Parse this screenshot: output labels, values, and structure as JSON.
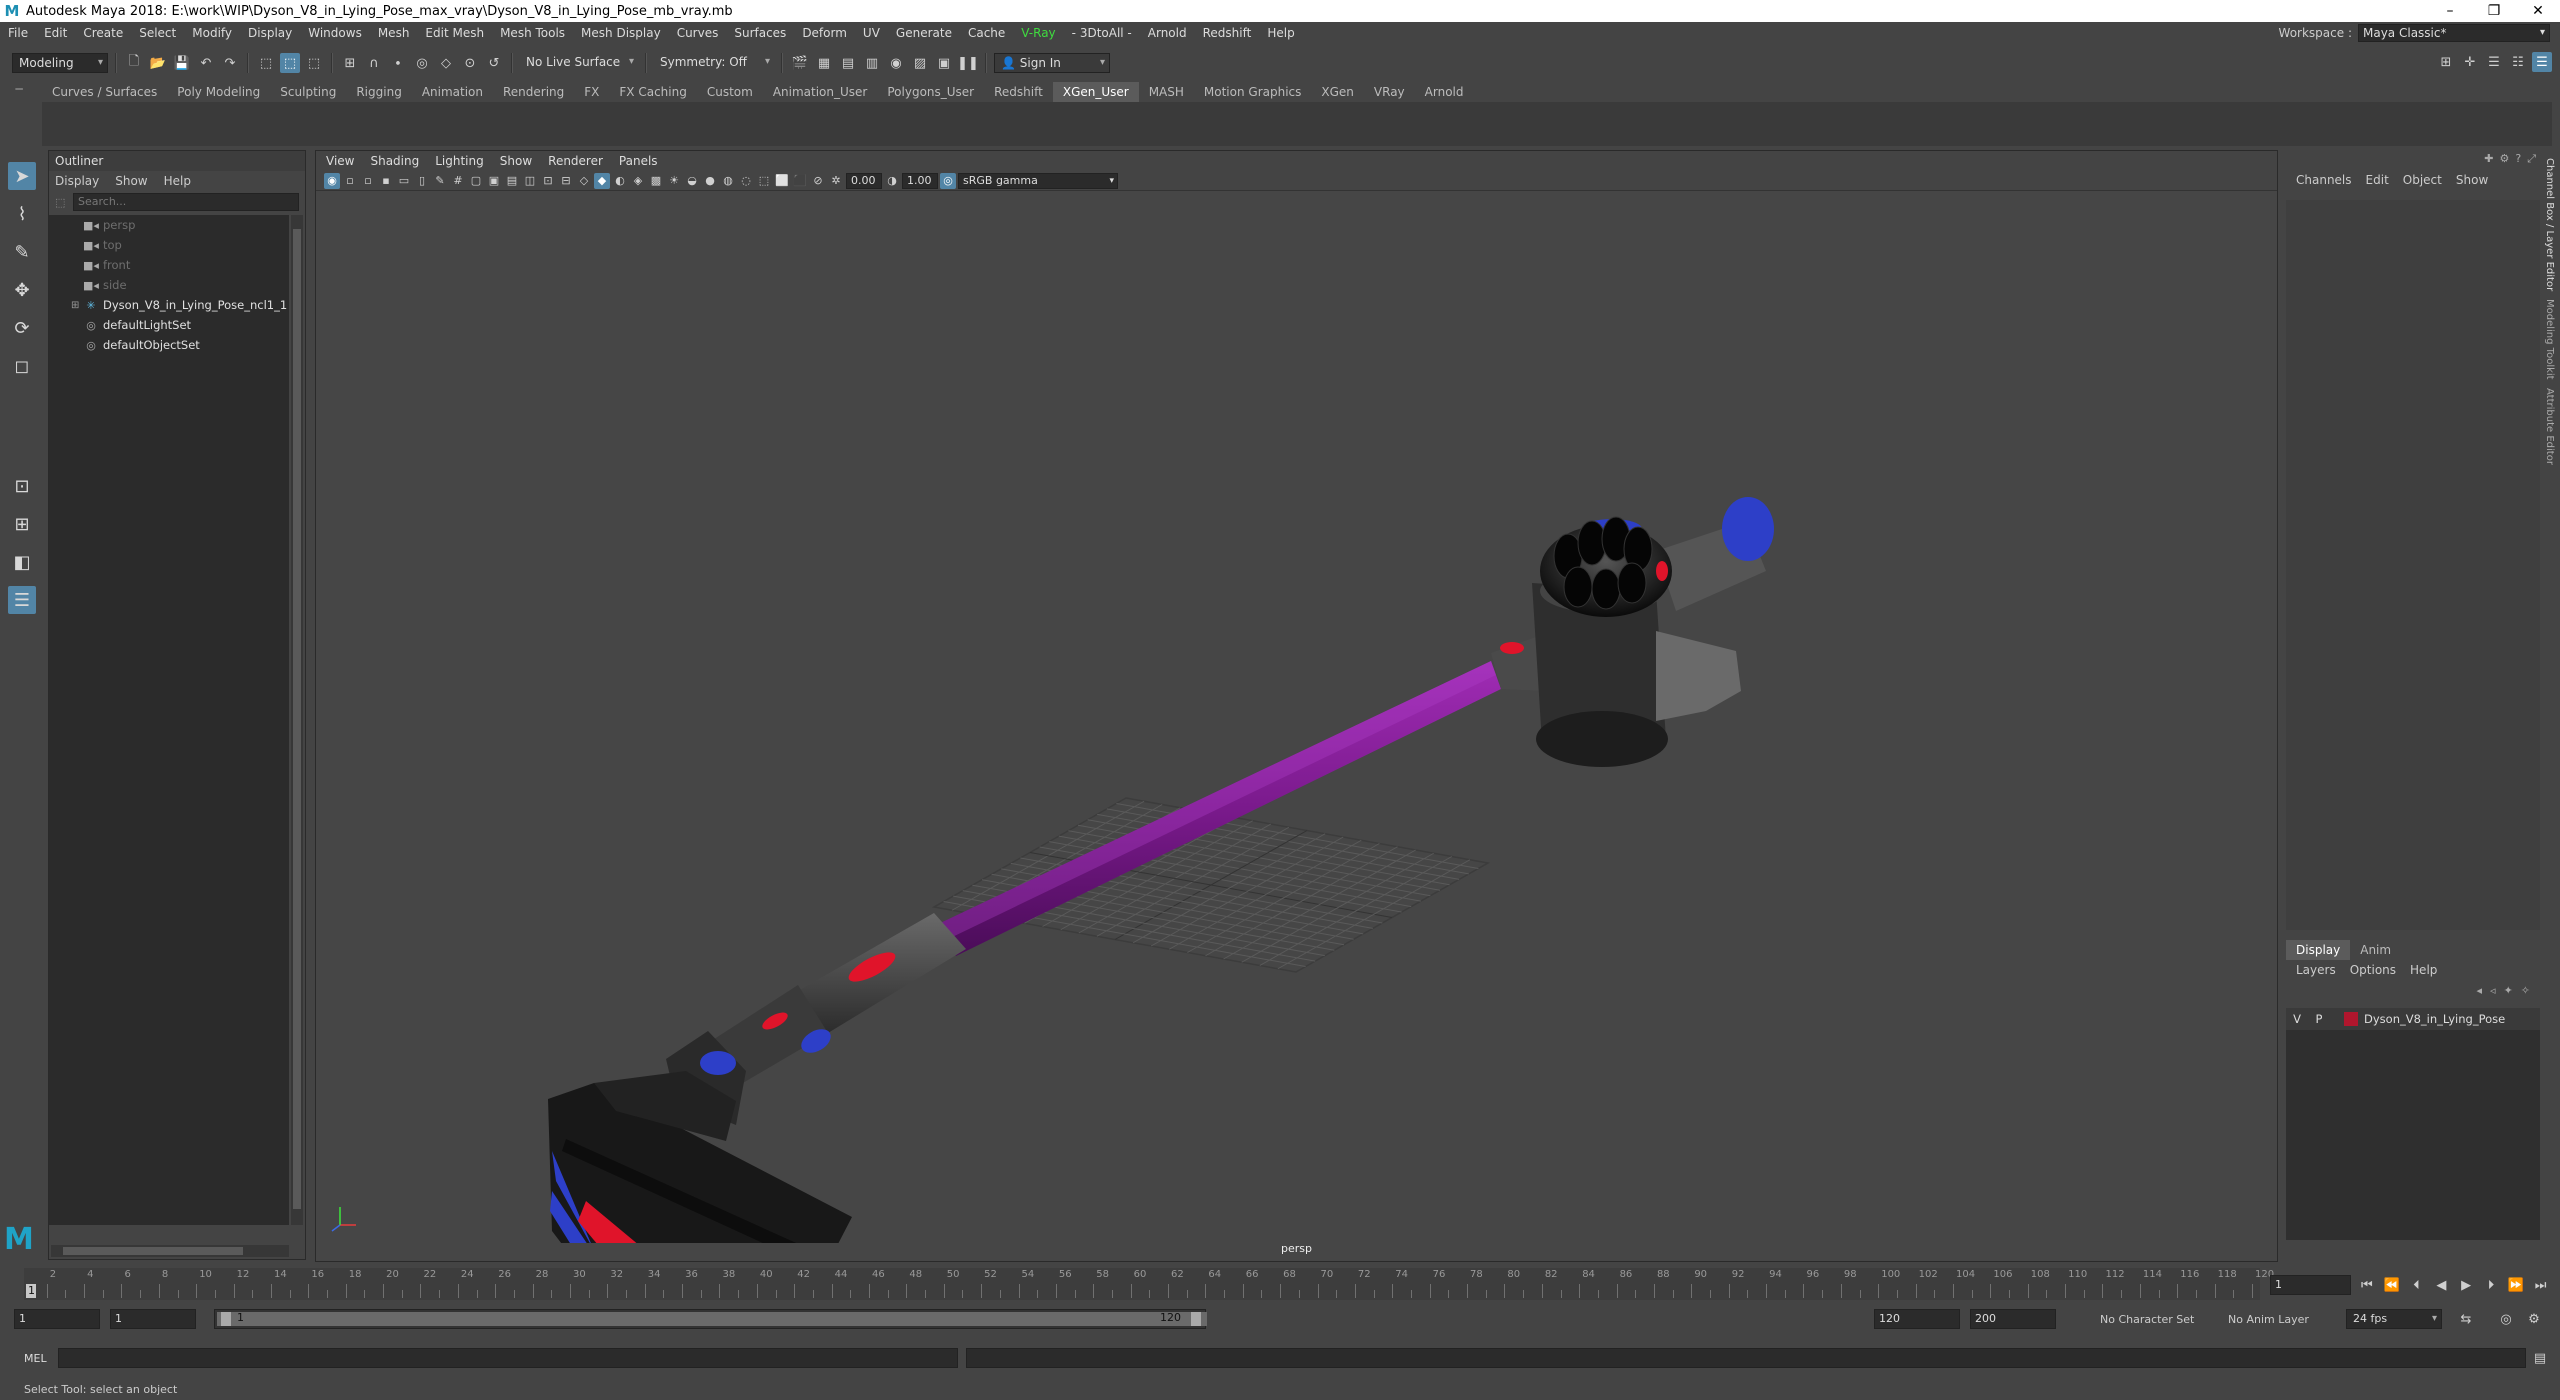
{
  "window": {
    "title": "Autodesk Maya 2018: E:\\work\\WIP\\Dyson_V8_in_Lying_Pose_max_vray\\Dyson_V8_in_Lying_Pose_mb_vray.mb",
    "logo": "M",
    "controls": [
      "–",
      "❐",
      "✕"
    ]
  },
  "menubar": [
    "File",
    "Edit",
    "Create",
    "Select",
    "Modify",
    "Display",
    "Windows",
    "Mesh",
    "Edit Mesh",
    "Mesh Tools",
    "Mesh Display",
    "Curves",
    "Surfaces",
    "Deform",
    "UV",
    "Generate",
    "Cache",
    "V-Ray",
    "- 3DtoAll -",
    "Arnold",
    "Redshift",
    "Help"
  ],
  "workspace": {
    "label": "Workspace :",
    "value": "Maya Classic*"
  },
  "statusline": {
    "mode": "Modeling",
    "live_surface": "No Live Surface",
    "symmetry": "Symmetry: Off",
    "sign_in": "Sign In"
  },
  "shelf_tabs": [
    "Curves / Surfaces",
    "Poly Modeling",
    "Sculpting",
    "Rigging",
    "Animation",
    "Rendering",
    "FX",
    "FX Caching",
    "Custom",
    "Animation_User",
    "Polygons_User",
    "Redshift",
    "XGen_User",
    "MASH",
    "Motion Graphics",
    "XGen",
    "VRay",
    "Arnold"
  ],
  "active_shelf": "XGen_User",
  "outliner": {
    "title": "Outliner",
    "menu": [
      "Display",
      "Show",
      "Help"
    ],
    "search_placeholder": "Search...",
    "items": [
      {
        "name": "persp",
        "type": "camera",
        "dim": true
      },
      {
        "name": "top",
        "type": "camera",
        "dim": true
      },
      {
        "name": "front",
        "type": "camera",
        "dim": true
      },
      {
        "name": "side",
        "type": "camera",
        "dim": true
      },
      {
        "name": "Dyson_V8_in_Lying_Pose_ncl1_1",
        "type": "group",
        "dim": false
      },
      {
        "name": "defaultLightSet",
        "type": "set",
        "dim": false
      },
      {
        "name": "defaultObjectSet",
        "type": "set",
        "dim": false
      }
    ]
  },
  "viewport": {
    "menu": [
      "View",
      "Shading",
      "Lighting",
      "Show",
      "Renderer",
      "Panels"
    ],
    "exposure": "0.00",
    "gamma": "1.00",
    "color_space": "sRGB gamma",
    "camera": "persp",
    "colors": {
      "tube": "#7a1a8c",
      "body": "#3c3c3c",
      "accent_red": "#e0142a",
      "accent_blue": "#2d3fc8"
    }
  },
  "channel_box": {
    "menu": [
      "Channels",
      "Edit",
      "Object",
      "Show"
    ]
  },
  "layer_editor": {
    "tabs": [
      "Display",
      "Anim"
    ],
    "menu": [
      "Layers",
      "Options",
      "Help"
    ],
    "layer": {
      "v": "V",
      "p": "P",
      "name": "Dyson_V8_in_Lying_Pose",
      "color": "#b0162d"
    }
  },
  "side_tabs": [
    "Channel Box / Layer Editor",
    "Modeling Toolkit",
    "Attribute Editor"
  ],
  "timeline": {
    "labels": [
      "2",
      "4",
      "6",
      "8",
      "10",
      "12",
      "14",
      "16",
      "18",
      "20",
      "22",
      "24",
      "26",
      "28",
      "30",
      "32",
      "34",
      "36",
      "38",
      "40",
      "42",
      "44",
      "46",
      "48",
      "50",
      "52",
      "54",
      "56",
      "58",
      "60",
      "62",
      "64",
      "66",
      "68",
      "70",
      "72",
      "74",
      "76",
      "78",
      "80",
      "82",
      "84",
      "86",
      "88",
      "90",
      "92",
      "94",
      "96",
      "98",
      "100",
      "102",
      "104",
      "106",
      "108",
      "110",
      "112",
      "114",
      "116",
      "118",
      "120"
    ],
    "current_frame": "1",
    "current_frame_field": "1"
  },
  "range": {
    "start": "1",
    "start2": "1",
    "slider_start": "1",
    "slider_end": "120",
    "end": "120",
    "end2": "200",
    "character_set": "No Character Set",
    "anim_layer": "No Anim Layer",
    "fps": "24 fps"
  },
  "cmdline": {
    "label": "MEL"
  },
  "helpline": {
    "text": "Select Tool: select an object"
  }
}
